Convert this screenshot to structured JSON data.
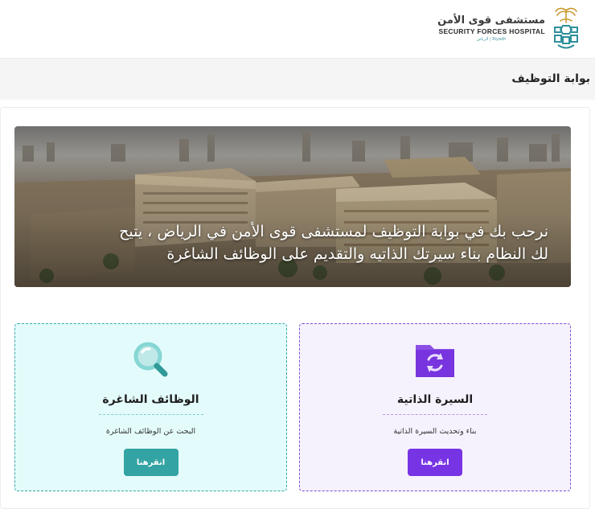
{
  "header": {
    "logo_ar": "مستشفى قوى الأمن",
    "logo_en": "SECURITY FORCES HOSPITAL",
    "logo_sub": "الرياض | Riyadh",
    "logo_icon": "palm-swords-emblem-icon"
  },
  "page": {
    "title": "بوابة التوظيف"
  },
  "hero": {
    "line1": "نرحب بك في بوابة التوظيف لمستشفى قوى الأمن في الرياض ، يتيح",
    "line2": "لك النظام بناء سيرتك الذاتيه والتقديم على الوظائف الشاغرة"
  },
  "cards": {
    "cv": {
      "title": "السيرة الذاتية",
      "description": "بناء وتحديث السيرة الذاتية",
      "button": "انقرهنا",
      "icon": "folder-refresh-icon",
      "accent": "#7734e4"
    },
    "jobs": {
      "title": "الوظائف الشاغرة",
      "description": "البحث عن الوظائف الشاغرة",
      "button": "انقرهنا",
      "icon": "search-icon",
      "accent": "#33a3a3"
    }
  }
}
